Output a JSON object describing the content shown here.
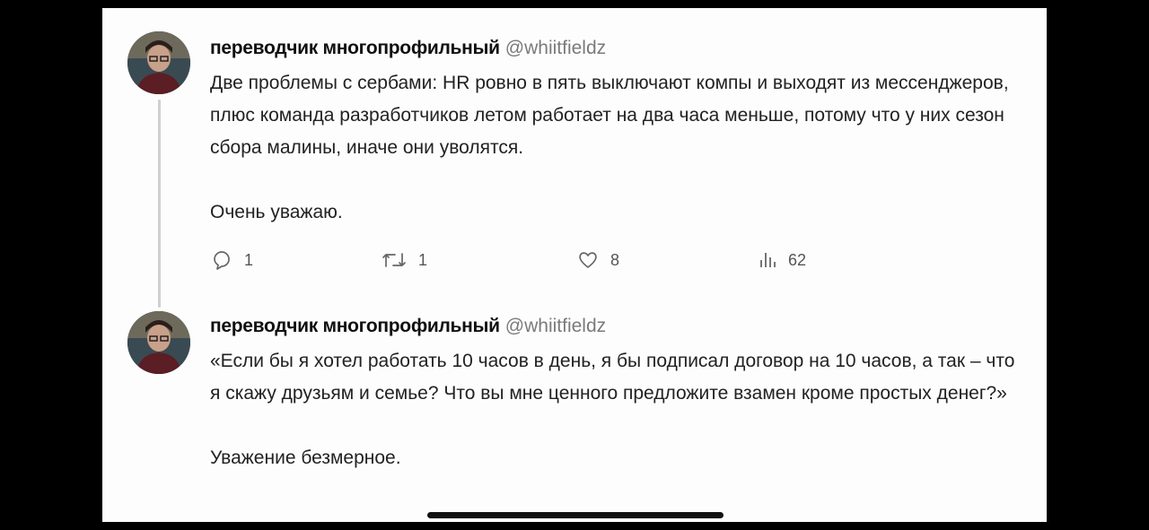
{
  "tweets": [
    {
      "author_name": "переводчик многопрофильный",
      "handle": "@whiitfieldz",
      "paragraphs": [
        "Две проблемы с сербами: HR ровно в пять выключают компы и выходят из мессенджеров, плюс команда разработчиков летом работает на два часа меньше, потому что у них сезон сбора малины, иначе они уволятся.",
        "Очень уважаю."
      ],
      "stats": {
        "replies": "1",
        "retweets": "1",
        "likes": "8",
        "views": "62"
      }
    },
    {
      "author_name": "переводчик многопрофильный",
      "handle": "@whiitfieldz",
      "paragraphs": [
        "«Если бы я хотел работать 10 часов в день, я бы подписал договор на 10 часов, а так – что я скажу друзьям и семье? Что вы мне ценного предложите взамен кроме простых денег?»",
        "Уважение безмерное."
      ]
    }
  ],
  "icons": {
    "reply": "reply-icon",
    "retweet": "retweet-icon",
    "like": "heart-icon",
    "views": "views-icon"
  }
}
